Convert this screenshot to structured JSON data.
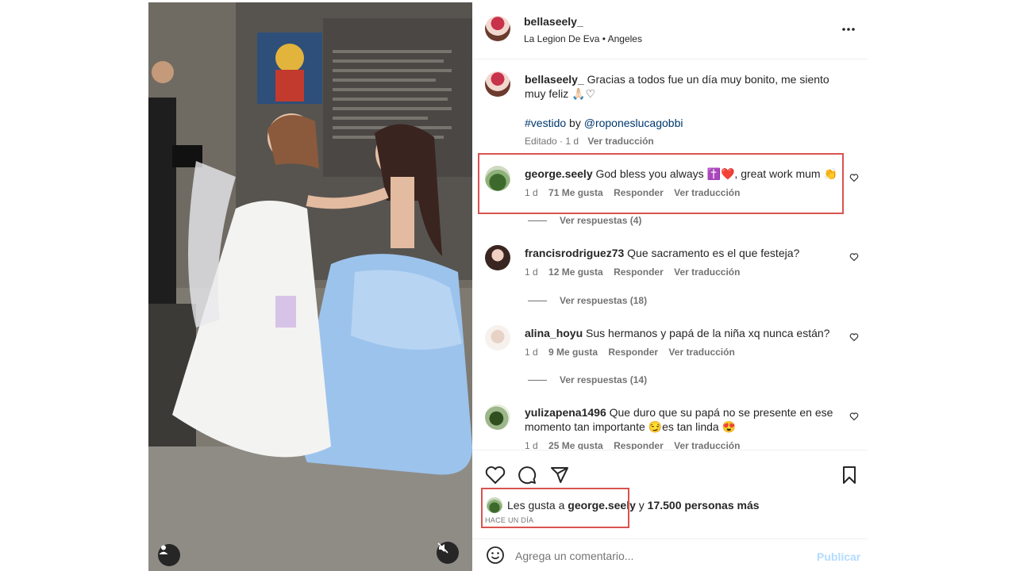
{
  "post": {
    "username": "bellaseely_",
    "location": "La Legion De Eva • Angeles",
    "caption_user": "bellaseely_",
    "caption_text": "Gracias a todos fue un día muy bonito, me siento",
    "caption_text_2": "muy feliz 🙏🏻♡",
    "hashtag": "#vestido",
    "by": "by",
    "mention": "@roponeslucagobbi",
    "edited_meta": "Editado · 1 d",
    "see_translation": "Ver traducción"
  },
  "comments": [
    {
      "user": "george.seely",
      "text": "God bless you always ✝️❤️, great work mum 👏",
      "age": "1 d",
      "likes": "71 Me gusta",
      "reply": "Responder",
      "translate": "Ver traducción",
      "replies": "Ver respuestas (4)"
    },
    {
      "user": "francisrodriguez73",
      "text": "Que sacramento es el que festeja?",
      "age": "1 d",
      "likes": "12 Me gusta",
      "reply": "Responder",
      "translate": "Ver traducción",
      "replies": "Ver respuestas (18)"
    },
    {
      "user": "alina_hoyu",
      "text": "Sus hermanos y papá de la niña xq nunca están?",
      "age": "1 d",
      "likes": "9 Me gusta",
      "reply": "Responder",
      "translate": "Ver traducción",
      "replies": "Ver respuestas (14)"
    },
    {
      "user": "yulizapena1496",
      "text": "Que duro que su papá no se presente en ese",
      "text_2": "momento tan importante 😏es tan linda 😍",
      "age": "1 d",
      "likes": "25 Me gusta",
      "reply": "Responder",
      "translate": "Ver traducción"
    }
  ],
  "likes_line": {
    "prefix": "Les gusta a",
    "user": "george.seely",
    "joiner": "y",
    "others": "17.500 personas más"
  },
  "timestamp": "HACE UN DÍA",
  "add_comment": {
    "placeholder": "Agrega un comentario...",
    "publish": "Publicar"
  },
  "colors": {
    "highlight_box": "#d9534f",
    "link": "#00376b",
    "muted": "#737373",
    "publish_disabled": "#b3dbff"
  },
  "icons": {
    "more": "more-options-icon",
    "like": "heart-icon",
    "comment": "comment-icon",
    "share": "share-icon",
    "save": "bookmark-icon",
    "emoji": "emoji-icon",
    "mute": "muted-speaker-icon",
    "tagged_user": "user-icon"
  }
}
